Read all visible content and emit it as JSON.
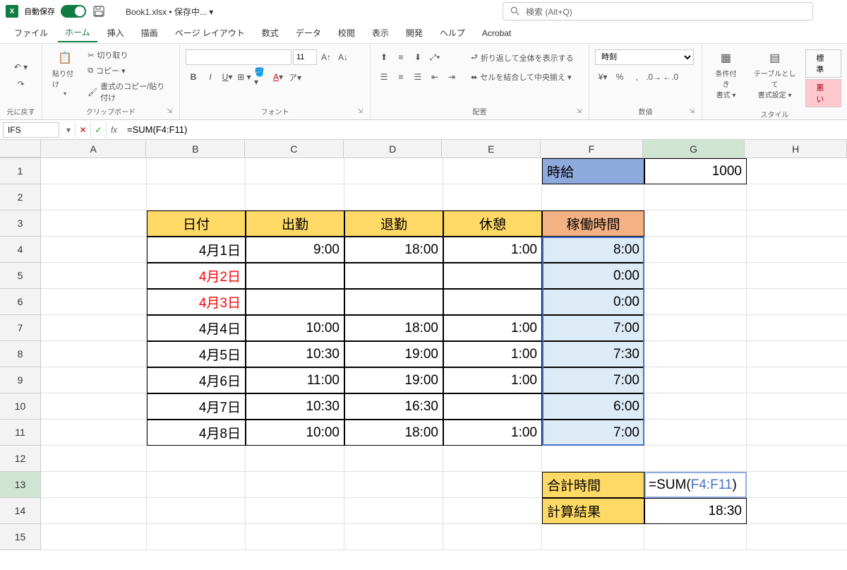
{
  "titlebar": {
    "autosave_label": "自動保存",
    "autosave_on": "オン",
    "filename": "Book1.xlsx • 保存中... ▾",
    "search_placeholder": "検索 (Alt+Q)"
  },
  "tabs": {
    "file": "ファイル",
    "home": "ホーム",
    "insert": "挿入",
    "draw": "描画",
    "page_layout": "ページ レイアウト",
    "formulas": "数式",
    "data": "データ",
    "review": "校閲",
    "view": "表示",
    "developer": "開発",
    "help": "ヘルプ",
    "acrobat": "Acrobat"
  },
  "ribbon": {
    "undo_group": "元に戻す",
    "clipboard": {
      "paste": "貼り付け",
      "cut": "切り取り",
      "copy": "コピー ▾",
      "format_painter": "書式のコピー/貼り付け",
      "label": "クリップボード"
    },
    "font": {
      "name": "",
      "size": "11",
      "label": "フォント"
    },
    "alignment": {
      "wrap": "折り返して全体を表示する",
      "merge": "セルを結合して中央揃え ▾",
      "label": "配置"
    },
    "number": {
      "format": "時刻",
      "label": "数値"
    },
    "styles": {
      "conditional": "条件付き\n書式 ▾",
      "table": "テーブルとして\n書式設定 ▾",
      "normal": "標準",
      "bad": "悪い",
      "label": "スタイル"
    }
  },
  "formula_bar": {
    "name_box": "IFS",
    "formula": "=SUM(F4:F11)"
  },
  "columns": [
    "A",
    "B",
    "C",
    "D",
    "E",
    "F",
    "G",
    "H"
  ],
  "rows": [
    "1",
    "2",
    "3",
    "4",
    "5",
    "6",
    "7",
    "8",
    "9",
    "10",
    "11",
    "12",
    "13",
    "14",
    "15"
  ],
  "cells": {
    "F1": "時給",
    "G1": "1000",
    "B3": "日付",
    "C3": "出勤",
    "D3": "退勤",
    "E3": "休憩",
    "F3": "稼働時間",
    "B4": "4月1日",
    "C4": "9:00",
    "D4": "18:00",
    "E4": "1:00",
    "F4": "8:00",
    "B5": "4月2日",
    "F5": "0:00",
    "B6": "4月3日",
    "F6": "0:00",
    "B7": "4月4日",
    "C7": "10:00",
    "D7": "18:00",
    "E7": "1:00",
    "F7": "7:00",
    "B8": "4月5日",
    "C8": "10:30",
    "D8": "19:00",
    "E8": "1:00",
    "F8": "7:30",
    "B9": "4月6日",
    "C9": "11:00",
    "D9": "19:00",
    "E9": "1:00",
    "F9": "7:00",
    "B10": "4月7日",
    "C10": "10:30",
    "D10": "16:30",
    "F10": "6:00",
    "B11": "4月8日",
    "C11": "10:00",
    "D11": "18:00",
    "E11": "1:00",
    "F11": "7:00",
    "F13": "合計時間",
    "G13_prefix": "=SUM(",
    "G13_ref": "F4:F11",
    "G13_suffix": ")",
    "F14": "計算結果",
    "G14": "18:30"
  }
}
